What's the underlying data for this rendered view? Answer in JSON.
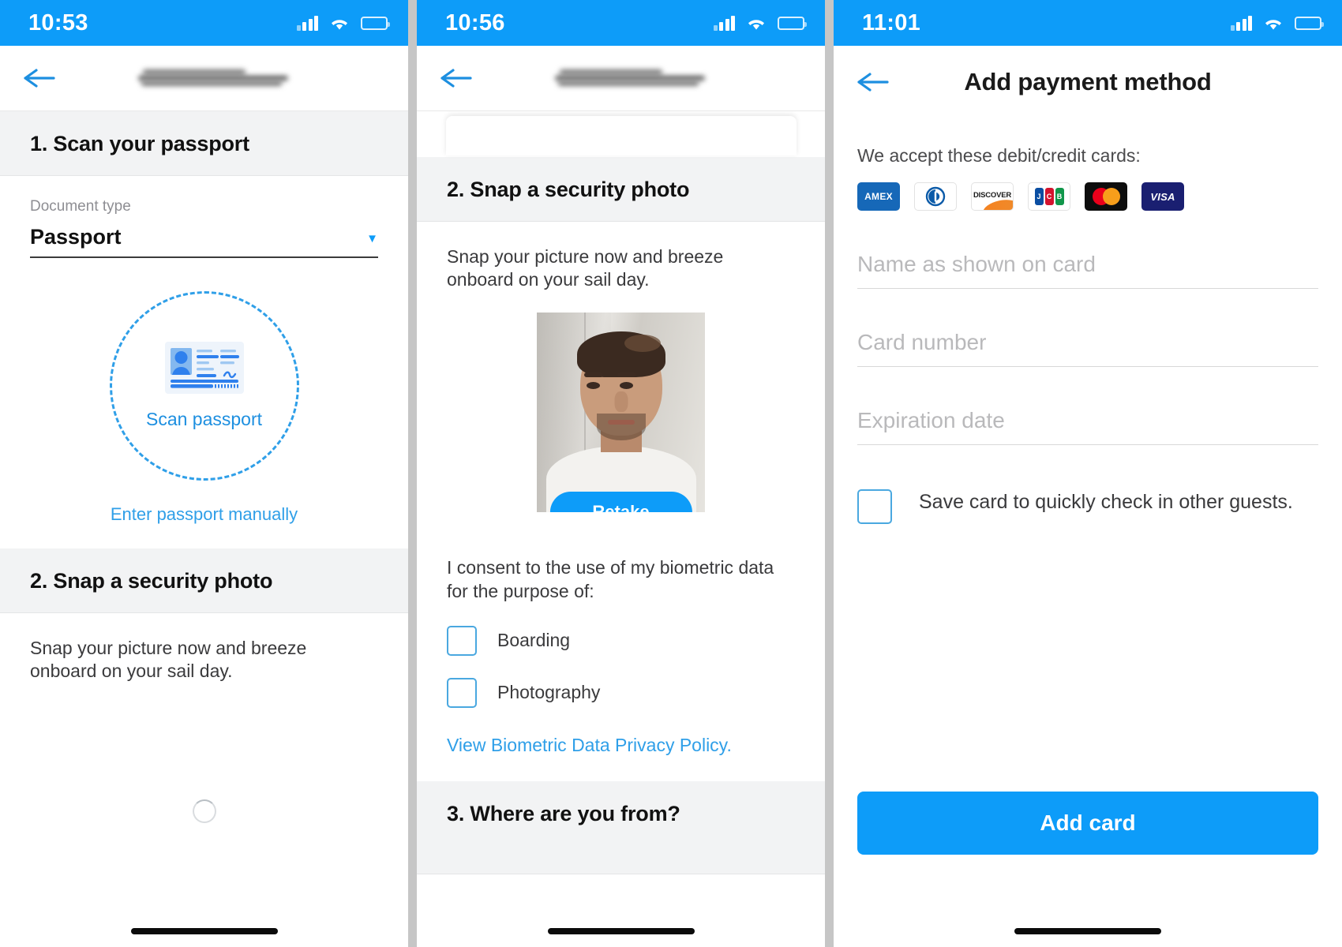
{
  "screen1": {
    "status": {
      "time": "10:53",
      "signal_icon": "cellular-signal-icon",
      "wifi_icon": "wifi-icon",
      "battery_icon": "battery-low-icon"
    },
    "nav": {
      "back_icon": "back-arrow-icon",
      "title_redacted": true
    },
    "section1": {
      "heading": "1. Scan your passport",
      "document_type_label": "Document type",
      "document_type_value": "Passport",
      "dropdown_icon": "chevron-down-icon",
      "scan_icon": "id-card-icon",
      "scan_label": "Scan passport",
      "manual_link": "Enter passport manually"
    },
    "section2": {
      "heading": "2. Snap a security photo",
      "body": "Snap your picture now and breeze onboard on your sail day."
    },
    "loading_icon": "loading-spinner-icon"
  },
  "screen2": {
    "status": {
      "time": "10:56",
      "signal_icon": "cellular-signal-icon",
      "wifi_icon": "wifi-icon",
      "battery_icon": "battery-low-icon"
    },
    "nav": {
      "back_icon": "back-arrow-icon",
      "title_redacted": true
    },
    "section2": {
      "heading": "2. Snap a security photo",
      "body": "Snap your picture now and breeze onboard on your sail day.",
      "photo_alt": "security-selfie-photo",
      "retake_label": "Retake",
      "consent_text": "I consent to the use of my biometric data for the purpose of:",
      "options": [
        {
          "label": "Boarding",
          "checked": false
        },
        {
          "label": "Photography",
          "checked": false
        }
      ],
      "policy_link": "View Biometric Data Privacy Policy."
    },
    "section3": {
      "heading": "3. Where are you from?"
    }
  },
  "screen3": {
    "status": {
      "time": "11:01",
      "signal_icon": "cellular-signal-icon",
      "wifi_icon": "wifi-icon",
      "battery_icon": "battery-low-icon"
    },
    "nav": {
      "back_icon": "back-arrow-icon",
      "title": "Add payment method"
    },
    "accept_line": "We accept these debit/credit cards:",
    "card_brands": [
      {
        "name": "AMEX",
        "id": "amex-logo"
      },
      {
        "name": "Diners Club",
        "id": "diners-club-logo"
      },
      {
        "name": "DISCOVER",
        "id": "discover-logo"
      },
      {
        "name": "JCB",
        "id": "jcb-logo"
      },
      {
        "name": "Mastercard",
        "id": "mastercard-logo"
      },
      {
        "name": "VISA",
        "id": "visa-logo"
      }
    ],
    "fields": [
      {
        "placeholder": "Name as shown on card",
        "value": ""
      },
      {
        "placeholder": "Card number",
        "value": ""
      },
      {
        "placeholder": "Expiration date",
        "value": ""
      }
    ],
    "save_card": {
      "label": "Save card to quickly check in other guests.",
      "checked": false
    },
    "submit_label": "Add card"
  },
  "colors": {
    "accent": "#0d9cf9",
    "link": "#2f9fe8",
    "section_bg": "#f2f3f4",
    "text": "#111111",
    "muted": "#8e8e93"
  }
}
